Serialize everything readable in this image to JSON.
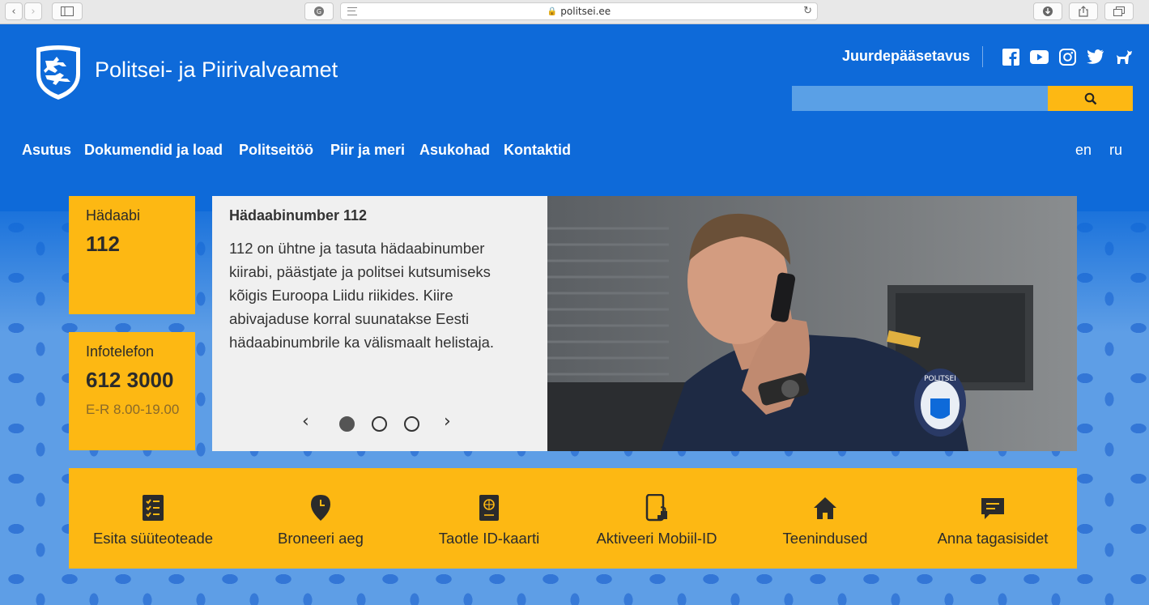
{
  "browser": {
    "url": "politsei.ee"
  },
  "header": {
    "site_title": "Politsei- ja Piirivalveamet",
    "accessibility_link": "Juurdepääsetavus",
    "social_icons": [
      "facebook-icon",
      "youtube-icon",
      "instagram-icon",
      "twitter-icon",
      "dog-icon"
    ],
    "search_placeholder": ""
  },
  "nav": {
    "items": [
      "Asutus",
      "Dokumendid ja load",
      "Politseitöö",
      "Piir ja meri",
      "Asukohad",
      "Kontaktid"
    ],
    "languages": [
      "en",
      "ru"
    ]
  },
  "emergency": {
    "label": "Hädaabi",
    "number": "112"
  },
  "infophone": {
    "label": "Infotelefon",
    "number": "612 3000",
    "hours": "E-R 8.00-19.00"
  },
  "slider": {
    "title": "Hädaabinumber 112",
    "text": "112 on ühtne ja tasuta hädaabinumber kiirabi, päästjate ja politsei kutsumiseks kõigis Euroopa Liidu riikides. Kiire abivajaduse korral suunatakse Eesti hädaabinumbrile ka välismaalt helistaja.",
    "slide_count": 3,
    "active_slide": 1,
    "badge_text": "POLITSEI"
  },
  "services": [
    {
      "label": "Esita süüteoteade",
      "icon": "checklist-icon"
    },
    {
      "label": "Broneeri aeg",
      "icon": "location-pin-clock-icon"
    },
    {
      "label": "Taotle ID-kaarti",
      "icon": "passport-icon"
    },
    {
      "label": "Aktiveeri Mobiil-ID",
      "icon": "mobile-lock-icon"
    },
    {
      "label": "Teenindused",
      "icon": "home-icon"
    },
    {
      "label": "Anna tagasisidet",
      "icon": "feedback-icon"
    }
  ],
  "colors": {
    "brand_blue": "#0e6ad9",
    "accent_yellow": "#fdb813",
    "pattern_blue": "#5e9ee6"
  }
}
